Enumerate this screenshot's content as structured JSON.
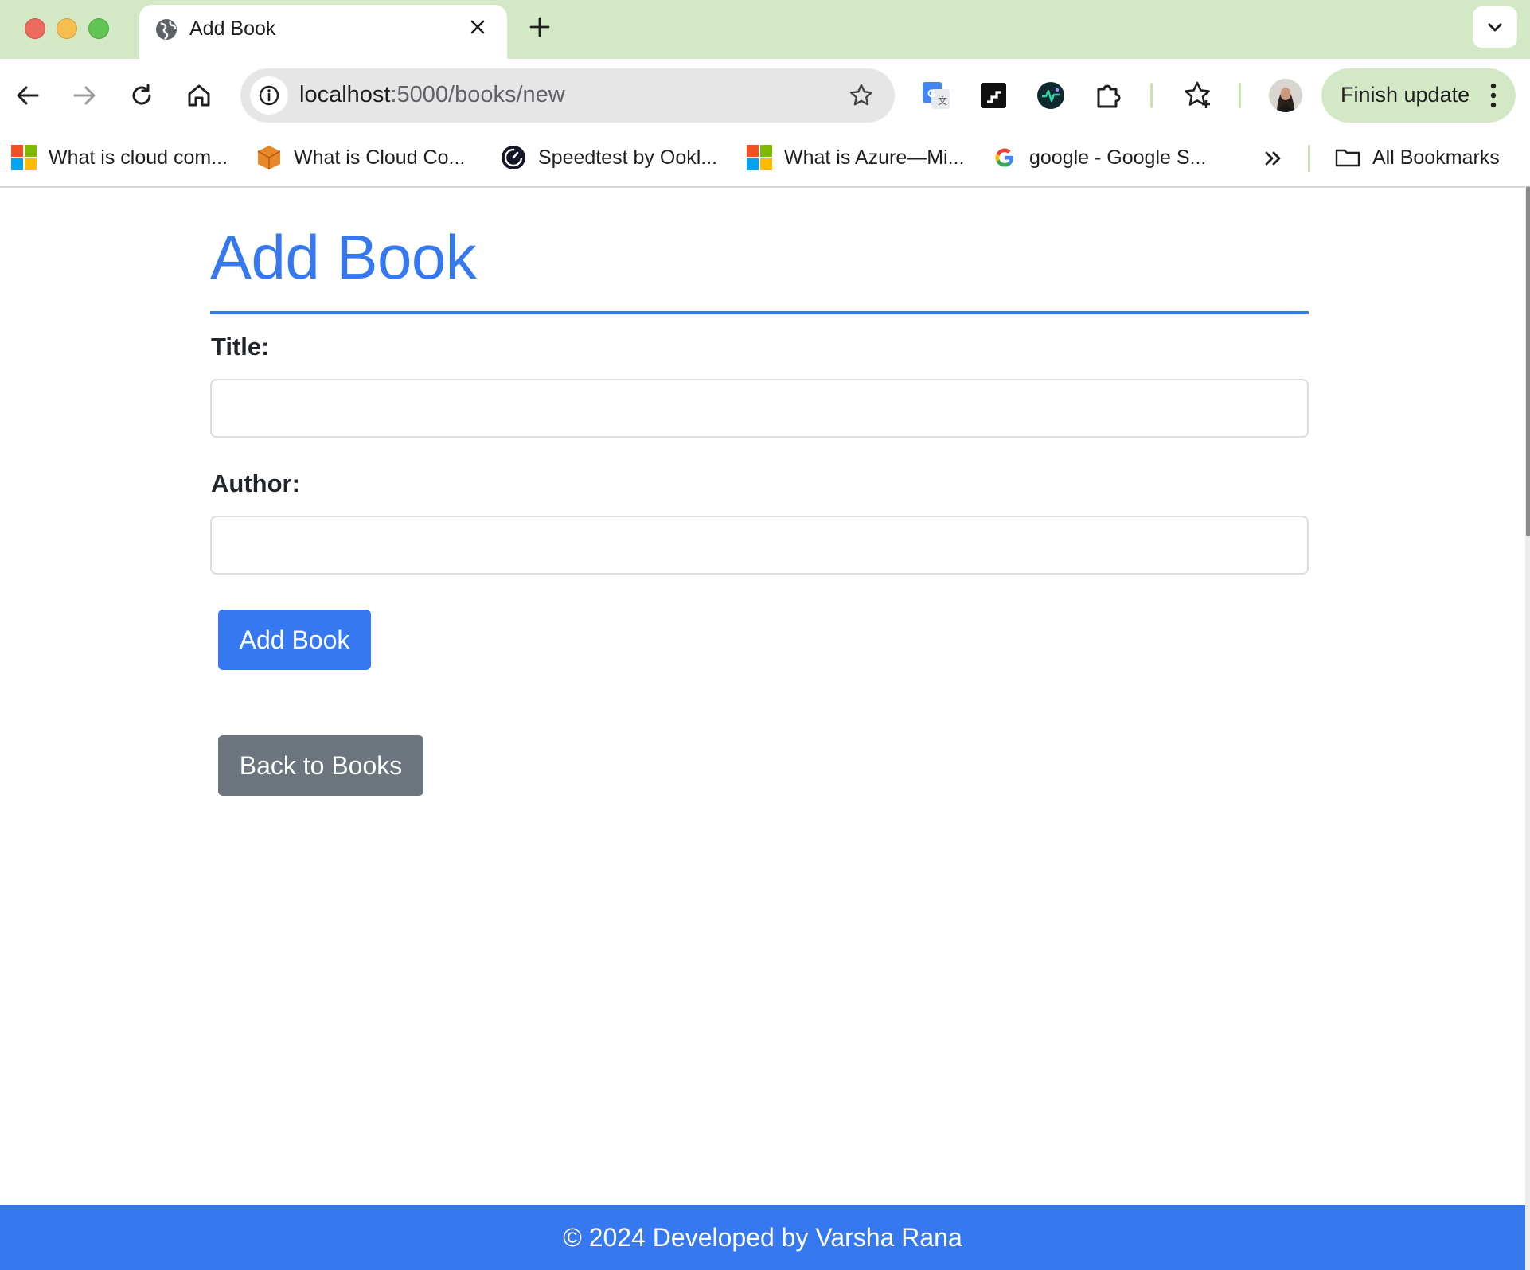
{
  "browser": {
    "tab": {
      "title": "Add Book",
      "favicon": "globe-icon"
    },
    "address_bar": {
      "host": "localhost",
      "path": ":5000/books/new"
    },
    "finish_update_label": "Finish update",
    "extensions": [
      "google-translate-icon",
      "readwise-icon",
      "ai-extension-icon",
      "puzzle-extensions-icon"
    ],
    "bookmarks": [
      {
        "label": "What is cloud com...",
        "icon": "microsoft-logo-icon"
      },
      {
        "label": "What is Cloud Co...",
        "icon": "aws-cube-icon"
      },
      {
        "label": "Speedtest by Ookl...",
        "icon": "speedtest-icon"
      },
      {
        "label": "What is Azure—Mi...",
        "icon": "microsoft-logo-icon"
      },
      {
        "label": "google - Google S...",
        "icon": "google-g-icon"
      }
    ],
    "all_bookmarks_label": "All Bookmarks"
  },
  "page": {
    "heading": "Add Book",
    "form": {
      "title_label": "Title:",
      "title_value": "",
      "author_label": "Author:",
      "author_value": "",
      "submit_label": "Add Book"
    },
    "back_label": "Back to Books",
    "footer": "© 2024 Developed by Varsha Rana"
  },
  "colors": {
    "accent": "#3578f0",
    "secondary_button": "#6c757d",
    "tabstrip": "#d3e9c5"
  }
}
